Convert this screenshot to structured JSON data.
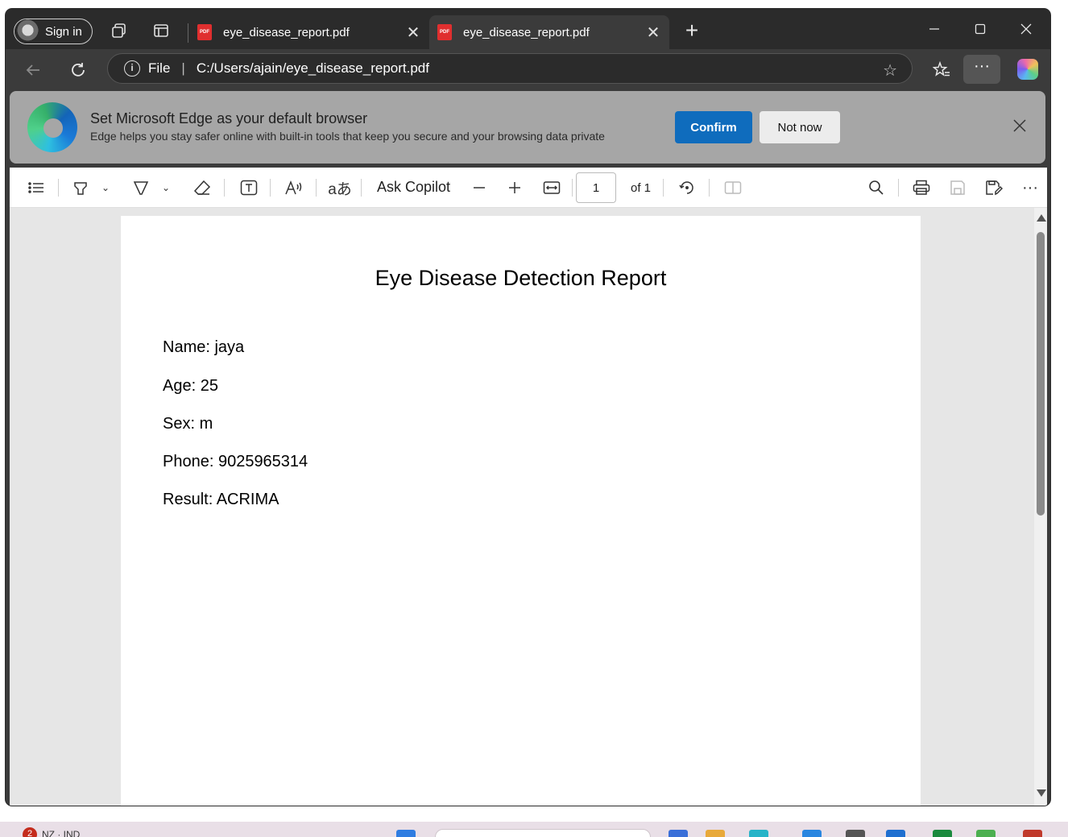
{
  "browser": {
    "signin_label": "Sign in",
    "tabs": [
      {
        "title": "eye_disease_report.pdf",
        "icon": "pdf-icon",
        "active": false
      },
      {
        "title": "eye_disease_report.pdf",
        "icon": "pdf-icon",
        "active": true
      }
    ],
    "tab_close_glyph": "✕",
    "address": {
      "scheme": "File",
      "divider": "|",
      "url": "C:/Users/ajain/eye_disease_report.pdf"
    },
    "more_glyph": "···"
  },
  "banner": {
    "title": "Set Microsoft Edge as your default browser",
    "subtitle": "Edge helps you stay safer online with built-in tools that keep you secure and your browsing data private",
    "confirm_label": "Confirm",
    "notnow_label": "Not now"
  },
  "pdf_toolbar": {
    "ask_copilot": "Ask Copilot",
    "page_number": "1",
    "page_total": "of 1"
  },
  "document": {
    "title": "Eye Disease Detection Report",
    "fields": [
      "Name: jaya",
      "Age: 25",
      "Sex: m",
      "Phone: 9025965314",
      "Result: ACRIMA"
    ]
  },
  "taskbar": {
    "badge": "2",
    "weather": "NZ · IND"
  },
  "colors": {
    "accent": "#0f6cbd",
    "pdf_red": "#e02f2f",
    "banner_bg": "#a6a6a6",
    "chrome_dark": "#2b2b2b"
  }
}
